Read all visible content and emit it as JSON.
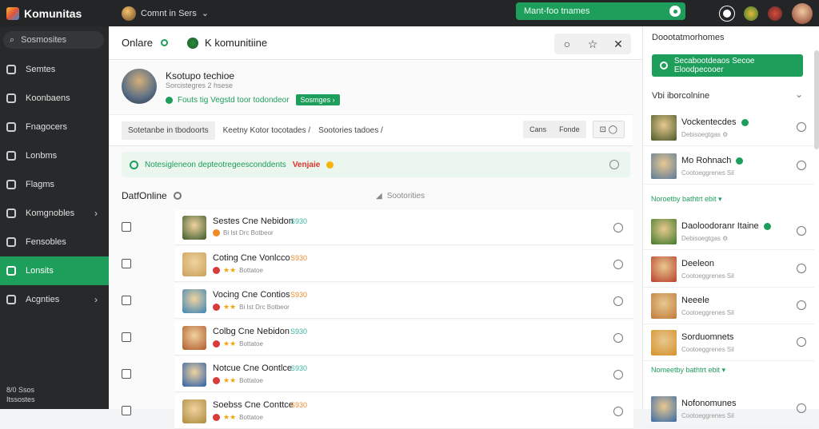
{
  "app": {
    "name": "Komunitas",
    "community_switch": "Comnt in Sers"
  },
  "topbar": {
    "search_placeholder": "Mant-foo tnames"
  },
  "sidebar": {
    "search_label": "Sosmosites",
    "items": [
      {
        "label": "Semtes",
        "icon": "home-icon"
      },
      {
        "label": "Koonbaens",
        "icon": "discover-icon"
      },
      {
        "label": "Fnagocers",
        "icon": "market-icon"
      },
      {
        "label": "Lonbms",
        "icon": "library-icon"
      },
      {
        "label": "Flagms",
        "icon": "globe-icon"
      },
      {
        "label": "Komgnobles",
        "icon": "controller-icon",
        "chevron": "›"
      },
      {
        "label": "Fensobles",
        "icon": "heart-icon"
      },
      {
        "label": "Lonsits",
        "icon": "community-icon",
        "active": true
      },
      {
        "label": "Acgnties",
        "icon": "search-icon",
        "chevron": "›"
      }
    ],
    "footer_line1": "8/0  Ssos",
    "footer_line2": "Itssostes"
  },
  "main": {
    "header_title": "Onlare",
    "group_name": "K komunitiine",
    "buttons": [
      "○",
      "☆",
      "✕"
    ],
    "profile": {
      "name": "Ksotupo techioe",
      "subtitle": "Sorcistegres 2 hsese",
      "status_line": "Fouts tig Vegstd toor todondeor",
      "badge": "Sosmges ›"
    },
    "tabs": {
      "active": "Sotetanbe in tbodoorts",
      "items": [
        "Keetny Kotor tocotades /",
        "Sootories tadoes /"
      ],
      "seg": [
        "Cans",
        "Fonde"
      ],
      "box": "⊡  ◯"
    },
    "alert": {
      "text": "Notesigleneon depteotregeesconddents",
      "hot": "Venjaie"
    },
    "list_title": "DatfOnline",
    "sort_label": "Sootorities",
    "rows": [
      {
        "name": "Sestes Cne Nebidon",
        "pts": "S930",
        "pts_color": "#3bb1a0",
        "sub": "Bi  Ist  Drc Botbeor"
      },
      {
        "name": "Coting Cne Vonlcco",
        "pts": "S930",
        "pts_color": "#e88a2e",
        "sub": "Bottatoe"
      },
      {
        "name": "Vocing Cne Contios",
        "pts": "S930",
        "pts_color": "#e88a2e",
        "sub": "Bi  Ist  Drc Botbeor"
      },
      {
        "name": "Colbg Cne Nebidon",
        "pts": "S930",
        "pts_color": "#3bb1a0",
        "sub": "Bottatoe"
      },
      {
        "name": "Notcue Cne Oontlce",
        "pts": "S930",
        "pts_color": "#3bb1a0",
        "sub": "Bottatoe"
      },
      {
        "name": "Soebss Cne Conttce",
        "pts": "S930",
        "pts_color": "#e88a2e",
        "sub": "Bottatoe"
      }
    ]
  },
  "right": {
    "title": "Doootatmorhomes",
    "button": "Secabootdeaos Secoe Eloodpecooer",
    "section": "Vbi iborcolnine",
    "users": [
      {
        "name": "Vockentecdes",
        "sub": "Debisoegtgas ⚙",
        "verified": true
      },
      {
        "name": "Mo Rohnach",
        "sub": "Cootoeggrenes Sil",
        "verified": true
      },
      {
        "name": "Daoloodoranr Itaine",
        "sub": "Debisoegtgas ⚙",
        "verified": true
      },
      {
        "name": "Deeleon",
        "sub": "Cootoeggrenes Sil",
        "verified": false
      },
      {
        "name": "Neeele",
        "sub": "Cootoeggrenes Sil",
        "verified": false
      },
      {
        "name": "Sorduomnets",
        "sub": "Cootoeggrenes Sil",
        "verified": false
      },
      {
        "name": "Nofonomunes",
        "sub": "Cootoeggrenes Sil",
        "verified": false
      }
    ],
    "label1": "Noroetby bathtrt ebit ▾",
    "label2": "Nomeetby bathtrt ebit ▾"
  }
}
